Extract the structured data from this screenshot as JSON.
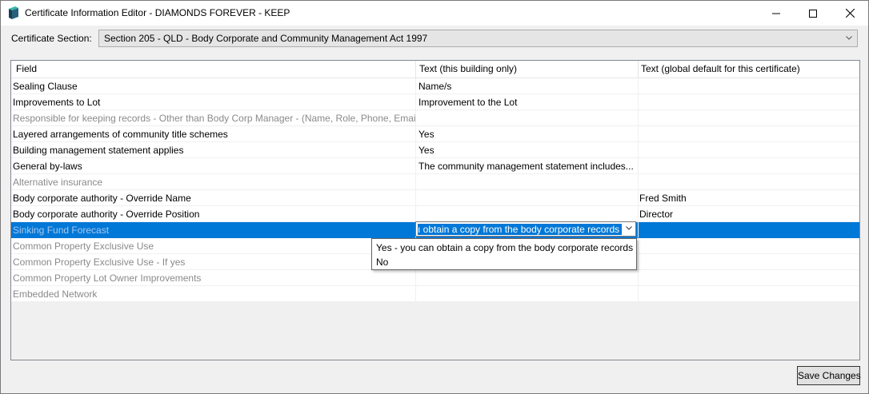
{
  "window": {
    "title": "Certificate Information Editor - DIAMONDS FOREVER - KEEP"
  },
  "section": {
    "label": "Certificate Section:",
    "value": "Section 205 - QLD - Body Corporate and Community Management Act 1997"
  },
  "grid": {
    "headers": [
      "Field",
      "Text (this building only)",
      "Text (global default for this certificate)"
    ],
    "rows": [
      {
        "field": "Sealing Clause",
        "building": "Name/s",
        "global": ""
      },
      {
        "field": "Improvements to Lot",
        "building": "Improvement to the Lot",
        "global": ""
      },
      {
        "field": "Responsible for keeping records - Other than Body Corp Manager - (Name, Role, Phone, Email)",
        "building": "",
        "global": ""
      },
      {
        "field": "Layered arrangements of community title schemes",
        "building": "Yes",
        "global": ""
      },
      {
        "field": "Building management statement applies",
        "building": "Yes",
        "global": ""
      },
      {
        "field": "General by-laws",
        "building": "The community management statement includes...",
        "global": ""
      },
      {
        "field": "Alternative insurance",
        "building": "",
        "global": ""
      },
      {
        "field": "Body corporate authority - Override Name",
        "building": "",
        "global": "Fred Smith"
      },
      {
        "field": "Body corporate authority - Override Position",
        "building": "",
        "global": "Director"
      },
      {
        "field": "Sinking Fund Forecast",
        "building": "",
        "global": ""
      },
      {
        "field": "Common Property Exclusive Use",
        "building": "",
        "global": ""
      },
      {
        "field": "Common Property Exclusive Use - If yes",
        "building": "",
        "global": ""
      },
      {
        "field": "Common Property Lot Owner Improvements",
        "building": "",
        "global": ""
      },
      {
        "field": "Embedded Network",
        "building": "",
        "global": ""
      }
    ],
    "editor_value": "ı obtain a copy from the body corporate records",
    "dropdown_options": [
      "Yes - you can obtain a copy from the body corporate records",
      "No"
    ]
  },
  "footer": {
    "save_label": "Save Changes"
  },
  "colors": {
    "selection": "#0078d7",
    "dim_text": "#8a8a8a"
  }
}
